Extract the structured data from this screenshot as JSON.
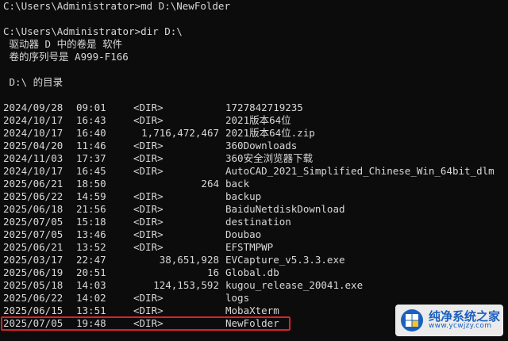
{
  "terminal": {
    "cmd1": "C:\\Users\\Administrator>md D:\\NewFolder",
    "cmd2": "C:\\Users\\Administrator>dir D:\\",
    "volume_line": " 驱动器 D 中的卷是 软件",
    "serial_line": " 卷的序列号是 A999-F166",
    "dir_of": " D:\\ 的目录",
    "entries": [
      {
        "date": "2024/09/28",
        "time": "09:01",
        "type": "<DIR>",
        "size": "",
        "name": "1727842719235"
      },
      {
        "date": "2024/10/17",
        "time": "16:43",
        "type": "<DIR>",
        "size": "",
        "name": "2021版本64位"
      },
      {
        "date": "2024/10/17",
        "time": "16:40",
        "type": "",
        "size": "1,716,472,467",
        "name": "2021版本64位.zip"
      },
      {
        "date": "2025/04/20",
        "time": "11:46",
        "type": "<DIR>",
        "size": "",
        "name": "360Downloads"
      },
      {
        "date": "2024/11/03",
        "time": "17:37",
        "type": "<DIR>",
        "size": "",
        "name": "360安全浏览器下载"
      },
      {
        "date": "2024/10/17",
        "time": "16:45",
        "type": "<DIR>",
        "size": "",
        "name": "AutoCAD_2021_Simplified_Chinese_Win_64bit_dlm"
      },
      {
        "date": "2025/06/21",
        "time": "18:50",
        "type": "",
        "size": "264",
        "name": "back"
      },
      {
        "date": "2025/06/22",
        "time": "14:59",
        "type": "<DIR>",
        "size": "",
        "name": "backup"
      },
      {
        "date": "2025/06/18",
        "time": "21:56",
        "type": "<DIR>",
        "size": "",
        "name": "BaiduNetdiskDownload"
      },
      {
        "date": "2025/07/05",
        "time": "15:18",
        "type": "<DIR>",
        "size": "",
        "name": "destination"
      },
      {
        "date": "2025/07/05",
        "time": "13:46",
        "type": "<DIR>",
        "size": "",
        "name": "Doubao"
      },
      {
        "date": "2025/06/21",
        "time": "13:52",
        "type": "<DIR>",
        "size": "",
        "name": "EFSTMPWP"
      },
      {
        "date": "2025/03/17",
        "time": "22:47",
        "type": "",
        "size": "38,651,928",
        "name": "EVCapture_v5.3.3.exe"
      },
      {
        "date": "2025/06/19",
        "time": "20:51",
        "type": "",
        "size": "16",
        "name": "Global.db"
      },
      {
        "date": "2025/05/18",
        "time": "14:03",
        "type": "",
        "size": "124,153,592",
        "name": "kugou_release_20041.exe"
      },
      {
        "date": "2025/06/22",
        "time": "14:02",
        "type": "<DIR>",
        "size": "",
        "name": "logs"
      },
      {
        "date": "2025/06/15",
        "time": "13:51",
        "type": "<DIR>",
        "size": "",
        "name": "MobaXterm"
      },
      {
        "date": "2025/07/05",
        "time": "19:48",
        "type": "<DIR>",
        "size": "",
        "name": "NewFolder"
      }
    ]
  },
  "highlight": {
    "color": "#e0202a",
    "row_index": 17
  },
  "watermark": {
    "title": "纯净系统之家",
    "url": "www.ycwjzy.com",
    "icon": "windows-logo-icon"
  },
  "colors": {
    "background": "#0c0c0c",
    "text": "#d8d8d8",
    "watermark_text": "#1b5fbf"
  }
}
